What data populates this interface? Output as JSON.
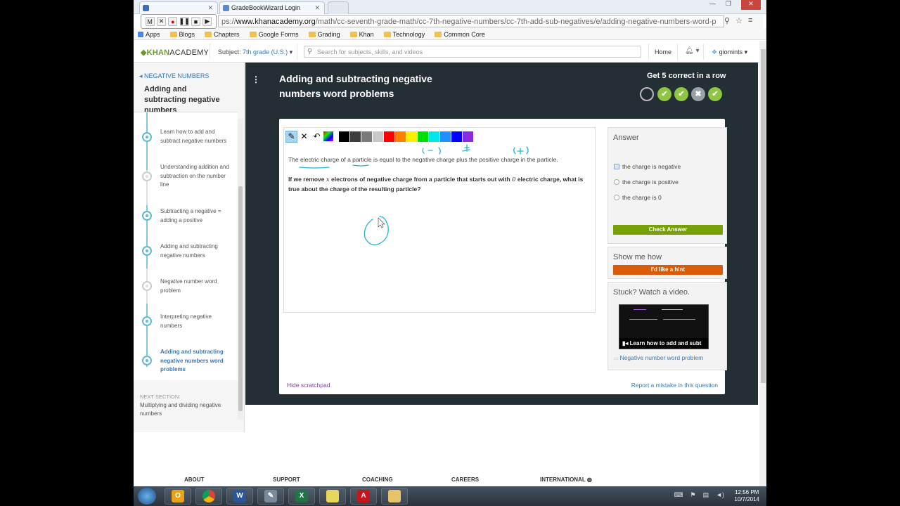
{
  "browser": {
    "tabs": [
      {
        "label": ""
      },
      {
        "label": "GradeBookWizard Login"
      }
    ],
    "url_prefix": "ps://",
    "url_host": "www.khanacademy.org",
    "url_path": "/math/cc-seventh-grade-math/cc-7th-negative-numbers/cc-7th-add-sub-negatives/e/adding-negative-numbers-word-p",
    "recorder": [
      "M",
      "✕",
      "●",
      "❚❚",
      "■",
      "▶"
    ],
    "bookmarks": [
      "Apps",
      "Blogs",
      "Chapters",
      "Google Forms",
      "Grading",
      "Khan",
      "Technology",
      "Common Core"
    ]
  },
  "header": {
    "logo_prefix": "KHAN",
    "logo_suffix": "ACADEMY",
    "subject_label": "Subject:",
    "subject_value": "7th grade (U.S.)",
    "search_placeholder": "Search for subjects, skills, and videos",
    "home": "Home",
    "user": "giomints"
  },
  "sidebar": {
    "back_link": "NEGATIVE NUMBERS",
    "title": "Adding and subtracting negative numbers",
    "items": [
      {
        "label": "Learn how to add and subtract negative numbers"
      },
      {
        "label": "Understanding addition and subtraction on the number line"
      },
      {
        "label": "Subtracting a negative = adding a positive"
      },
      {
        "label": "Adding and subtracting negative numbers"
      },
      {
        "label": "Negative number word problem"
      },
      {
        "label": "Interpreting negative numbers"
      },
      {
        "label": "Adding and subtracting negative numbers word problems"
      }
    ],
    "next_section_label": "NEXT SECTION:",
    "next_section": "Multiplying and dividing negative numbers"
  },
  "exercise": {
    "title": "Adding and subtracting negative numbers word problems",
    "streak_title": "Get 5 correct in a row",
    "streak": [
      "empty",
      "correct",
      "correct",
      "wrong",
      "correct"
    ],
    "question_line1": "The electric charge of a particle is equal to the negative charge plus the positive charge in the particle.",
    "question_line2_a": "If we remove",
    "question_var": "x",
    "question_line2_b": "electrons of negative charge from a particle that starts out with",
    "question_zero": "0",
    "question_line2_c": "electric charge, what is true about the charge of the resulting particle?",
    "scratch_colors": [
      "#000000",
      "#3d3d3d",
      "#7a7a7a",
      "#c8c8c8",
      "#ff0000",
      "#ff7f00",
      "#ffee00",
      "#00e000",
      "#00e8ee",
      "#1e90ff",
      "#0000ff",
      "#8a2be2"
    ]
  },
  "answer": {
    "title": "Answer",
    "options": [
      "the charge is negative",
      "the charge is positive",
      "the charge is 0"
    ],
    "check_button": "Check Answer"
  },
  "showme": {
    "title": "Show me how",
    "hint_button": "I'd like a hint"
  },
  "stuck": {
    "title": "Stuck? Watch a video.",
    "video_caption": "Learn how to add and subt",
    "video_link": "Negative number word problem"
  },
  "card_footer": {
    "hide_scratchpad": "Hide scratchpad",
    "report": "Report a mistake in this question"
  },
  "footer": [
    "ABOUT",
    "SUPPORT",
    "COACHING",
    "CAREERS",
    "INTERNATIONAL"
  ],
  "taskbar": {
    "time": "12:56 PM",
    "date": "10/7/2014"
  }
}
